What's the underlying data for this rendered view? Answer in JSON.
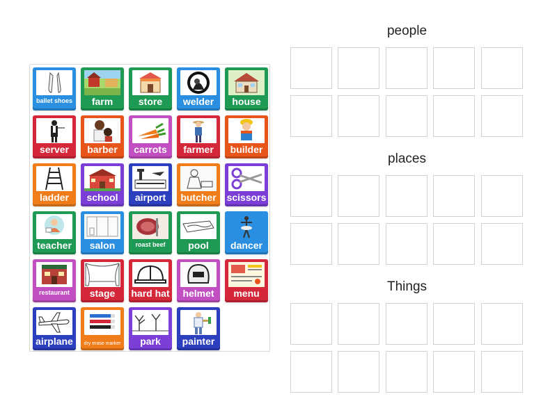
{
  "groups": [
    {
      "title": "people"
    },
    {
      "title": "places"
    },
    {
      "title": "Things"
    }
  ],
  "colors": {
    "blue": "#2a8fe0",
    "green": "#1f9a55",
    "red": "#d4283a",
    "orange": "#f07d1a",
    "purple": "#7b3fd8",
    "magenta": "#c24fc2",
    "navy": "#2b3fbf",
    "deep_orange": "#e8551b"
  },
  "cards": [
    {
      "label": "ballet shoes",
      "color": "#2a8fe0",
      "icon": "ballet-shoes-icon",
      "size": "sm"
    },
    {
      "label": "farm",
      "color": "#1f9a55",
      "icon": "farm-icon"
    },
    {
      "label": "store",
      "color": "#1f9a55",
      "icon": "store-icon"
    },
    {
      "label": "welder",
      "color": "#2a8fe0",
      "icon": "welder-icon"
    },
    {
      "label": "house",
      "color": "#1f9a55",
      "icon": "house-icon"
    },
    {
      "label": "server",
      "color": "#d4283a",
      "icon": "server-icon"
    },
    {
      "label": "barber",
      "color": "#e8551b",
      "icon": "barber-icon"
    },
    {
      "label": "carrots",
      "color": "#c24fc2",
      "icon": "carrots-icon"
    },
    {
      "label": "farmer",
      "color": "#d4283a",
      "icon": "farmer-icon"
    },
    {
      "label": "builder",
      "color": "#e8551b",
      "icon": "builder-icon"
    },
    {
      "label": "ladder",
      "color": "#f07d1a",
      "icon": "ladder-icon"
    },
    {
      "label": "school",
      "color": "#7b3fd8",
      "icon": "school-icon"
    },
    {
      "label": "airport",
      "color": "#2b3fbf",
      "icon": "airport-icon"
    },
    {
      "label": "butcher",
      "color": "#f07d1a",
      "icon": "butcher-icon"
    },
    {
      "label": "scissors",
      "color": "#7b3fd8",
      "icon": "scissors-icon"
    },
    {
      "label": "teacher",
      "color": "#1f9a55",
      "icon": "teacher-icon"
    },
    {
      "label": "salon",
      "color": "#2a8fe0",
      "icon": "salon-icon"
    },
    {
      "label": "roast beef",
      "color": "#1f9a55",
      "icon": "roast-beef-icon",
      "size": "sm"
    },
    {
      "label": "pool",
      "color": "#1f9a55",
      "icon": "pool-icon"
    },
    {
      "label": "dancer",
      "color": "#2a8fe0",
      "icon": "dancer-icon"
    },
    {
      "label": "restaurant",
      "color": "#c24fc2",
      "icon": "restaurant-icon",
      "size": "sm"
    },
    {
      "label": "stage",
      "color": "#d4283a",
      "icon": "stage-icon"
    },
    {
      "label": "hard hat",
      "color": "#d4283a",
      "icon": "hard-hat-icon"
    },
    {
      "label": "helmet",
      "color": "#c24fc2",
      "icon": "helmet-icon"
    },
    {
      "label": "menu",
      "color": "#d4283a",
      "icon": "menu-icon"
    },
    {
      "label": "airplane",
      "color": "#2b3fbf",
      "icon": "airplane-icon"
    },
    {
      "label": "dry erase marker",
      "color": "#f07d1a",
      "icon": "dry-erase-marker-icon",
      "size": "xs"
    },
    {
      "label": "park",
      "color": "#7b3fd8",
      "icon": "park-icon"
    },
    {
      "label": "painter",
      "color": "#2b3fbf",
      "icon": "painter-icon"
    }
  ]
}
